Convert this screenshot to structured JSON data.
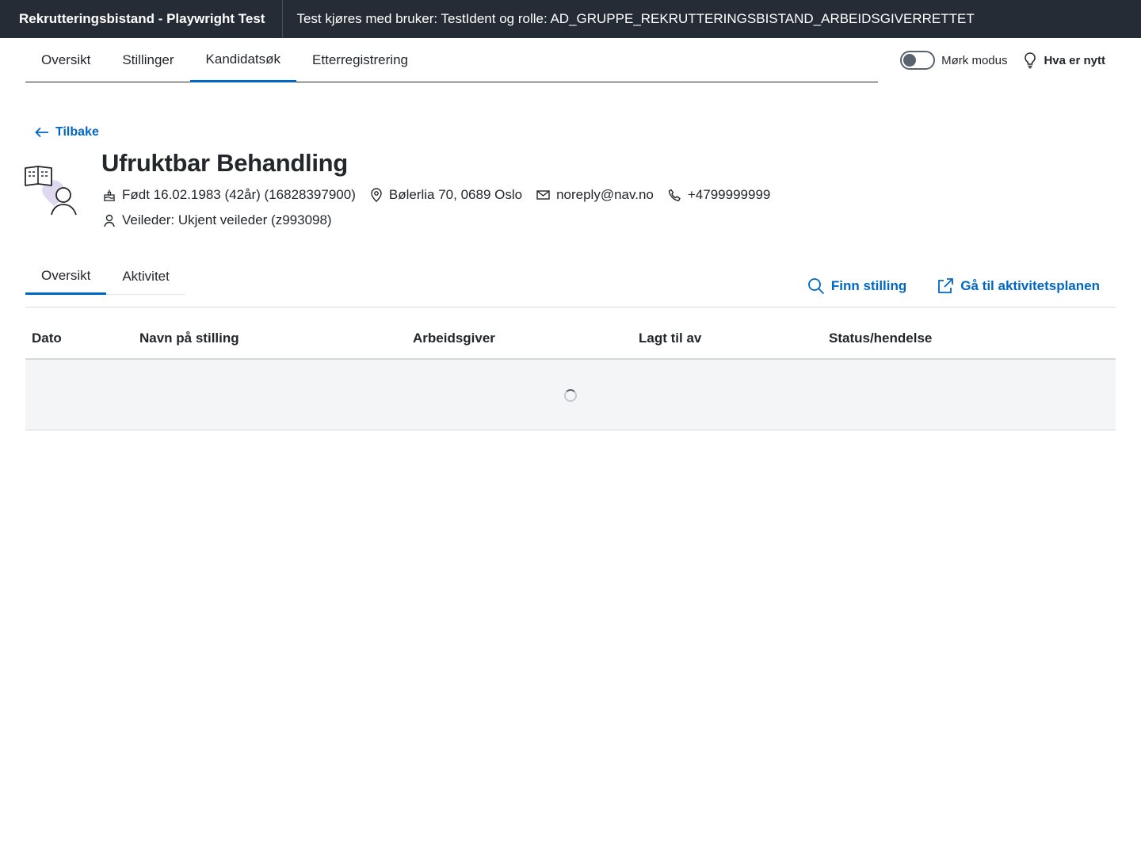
{
  "header": {
    "app_title": "Rekrutteringsbistand - Playwright Test",
    "test_info": "Test kjøres med bruker: TestIdent og rolle: AD_GRUPPE_REKRUTTERINGSBISTAND_ARBEIDSGIVERRETTET"
  },
  "nav": {
    "tabs": [
      {
        "label": "Oversikt"
      },
      {
        "label": "Stillinger"
      },
      {
        "label": "Kandidatsøk"
      },
      {
        "label": "Etterregistrering"
      }
    ],
    "active_tab": "Kandidatsøk",
    "dark_mode_label": "Mørk modus",
    "dark_mode_on": false,
    "whats_new_label": "Hva er nytt"
  },
  "back_label": "Tilbake",
  "candidate": {
    "name": "Ufruktbar Behandling",
    "born": "Født 16.02.1983 (42år) (16828397900)",
    "address": "Bølerlia 70, 0689 Oslo",
    "email": "noreply@nav.no",
    "phone": "+4799999999",
    "supervisor": "Veileder: Ukjent veileder (z993098)"
  },
  "subtabs": [
    {
      "label": "Oversikt"
    },
    {
      "label": "Aktivitet"
    }
  ],
  "actions": {
    "find_job": "Finn stilling",
    "activity_plan": "Gå til aktivitetsplanen"
  },
  "table": {
    "columns": [
      "Dato",
      "Navn på stilling",
      "Arbeidsgiver",
      "Lagt til av",
      "Status/hendelse"
    ],
    "loading": true
  },
  "colors": {
    "accent": "#0067c5",
    "topbar": "#262c36",
    "illustration_accent": "#e0d8ef"
  }
}
